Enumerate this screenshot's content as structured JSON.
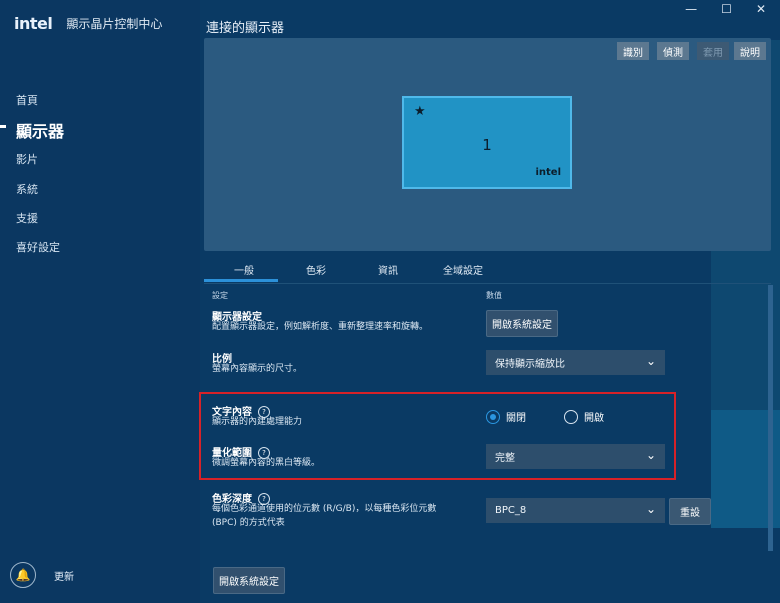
{
  "app": {
    "logo": "intel",
    "title": "顯示晶片控制中心"
  },
  "window": {
    "minimize": "—",
    "maximize": "☐",
    "close": "✕"
  },
  "sidebar": {
    "items": [
      {
        "label": "首頁"
      },
      {
        "label": "顯示器"
      },
      {
        "label": "影片"
      },
      {
        "label": "系統"
      },
      {
        "label": "支援"
      },
      {
        "label": "喜好設定"
      }
    ],
    "update_label": "更新"
  },
  "page": {
    "title": "連接的顯示器"
  },
  "preview": {
    "toolbar": [
      "識別",
      "偵測",
      "套用",
      "說明"
    ],
    "monitor": {
      "number": "1",
      "brand": "intel"
    }
  },
  "tabs": [
    "一般",
    "色彩",
    "資訊",
    "全域設定"
  ],
  "columns": {
    "setting": "設定",
    "value": "數值"
  },
  "settings": {
    "display": {
      "title": "顯示器設定",
      "desc": "配置顯示器設定，例如解析度、重新整理速率和旋轉。",
      "button": "開啟系統設定"
    },
    "scale": {
      "title": "比例",
      "desc": "螢幕內容顯示的尺寸。",
      "value": "保持顯示縮放比"
    },
    "text": {
      "title": "文字內容",
      "desc": "顯示器的內建處理能力",
      "options": [
        "關閉",
        "開啟"
      ],
      "selected": "關閉"
    },
    "quant": {
      "title": "量化範圍",
      "desc": "微調螢幕內容的黑白等級。",
      "value": "完整"
    },
    "depth": {
      "title": "色彩深度",
      "desc_line1": "每個色彩通道使用的位元數 (R/G/B)，以每種色彩位元數",
      "desc_line2": "(BPC) 的方式代表",
      "value": "BPC_8",
      "reset": "重設"
    }
  },
  "footer": {
    "button": "開啟系統設定"
  }
}
